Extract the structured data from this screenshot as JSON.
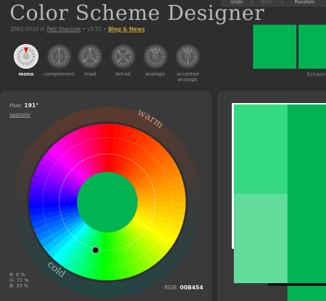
{
  "header": {
    "title": "Color Scheme Designer",
    "subtitle_prefix": "2002-2010 ©",
    "author": "Petr Stanicek",
    "version": "• v3.51 •",
    "blog_link": "Blog & News"
  },
  "toolbar": {
    "undo_label": "Undo",
    "redo_label": "Redo",
    "random_label": "Random"
  },
  "schemes": [
    {
      "label": "mono",
      "active": true
    },
    {
      "label": "complement",
      "active": false
    },
    {
      "label": "triad",
      "active": false
    },
    {
      "label": "tetrad",
      "active": false
    },
    {
      "label": "analogic",
      "active": false
    },
    {
      "label": "accented analogic",
      "active": false
    }
  ],
  "right_tab": {
    "label": "Schem"
  },
  "hue": {
    "label": "Hue:",
    "value": "191°",
    "opposite_label": "opposite"
  },
  "wheel": {
    "warm_label": "warm",
    "cold_label": "cold"
  },
  "rgb": {
    "r": "R:  0 %",
    "g": "G: 71 %",
    "b": "B: 33 %",
    "hex_label": "RGB:",
    "hex_value": "00B454"
  },
  "colors": {
    "base": "#00b454",
    "light1": "#35da82",
    "light2": "#62dc9b",
    "panel": "#3a3a3a",
    "background": "#2e2e2e",
    "link_accent": "#c9a238"
  }
}
